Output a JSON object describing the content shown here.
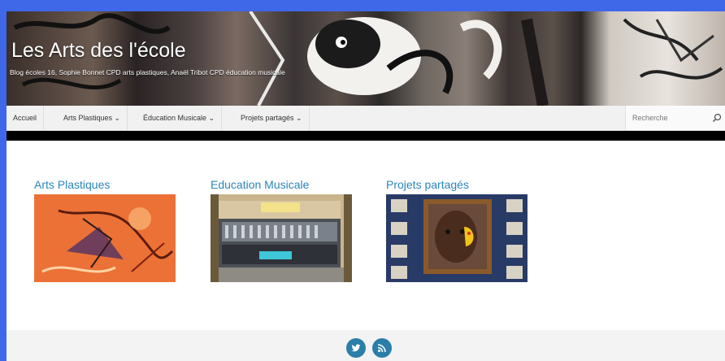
{
  "site": {
    "title": "Les Arts des l'école",
    "description": "Blog écoles 16, Sophie Bonnet CPD arts plastiques, Anaël Tribot CPD éducation musicale"
  },
  "nav": {
    "items": [
      {
        "label": "Accueil"
      },
      {
        "label": "Arts Plastiques ⌄"
      },
      {
        "label": "Éducation Musicale ⌄"
      },
      {
        "label": "Projets partagés ⌄"
      }
    ],
    "search_placeholder": "Recherche"
  },
  "cards": [
    {
      "title": "Arts Plastiques"
    },
    {
      "title": "Education Musicale"
    },
    {
      "title": "Projets partagés"
    }
  ],
  "icons": {
    "search": "search-icon",
    "twitter": "twitter-icon",
    "rss": "rss-icon"
  },
  "colors": {
    "accent": "#2a86b8",
    "border": "#3f68e8",
    "social": "#2a7ea8"
  }
}
